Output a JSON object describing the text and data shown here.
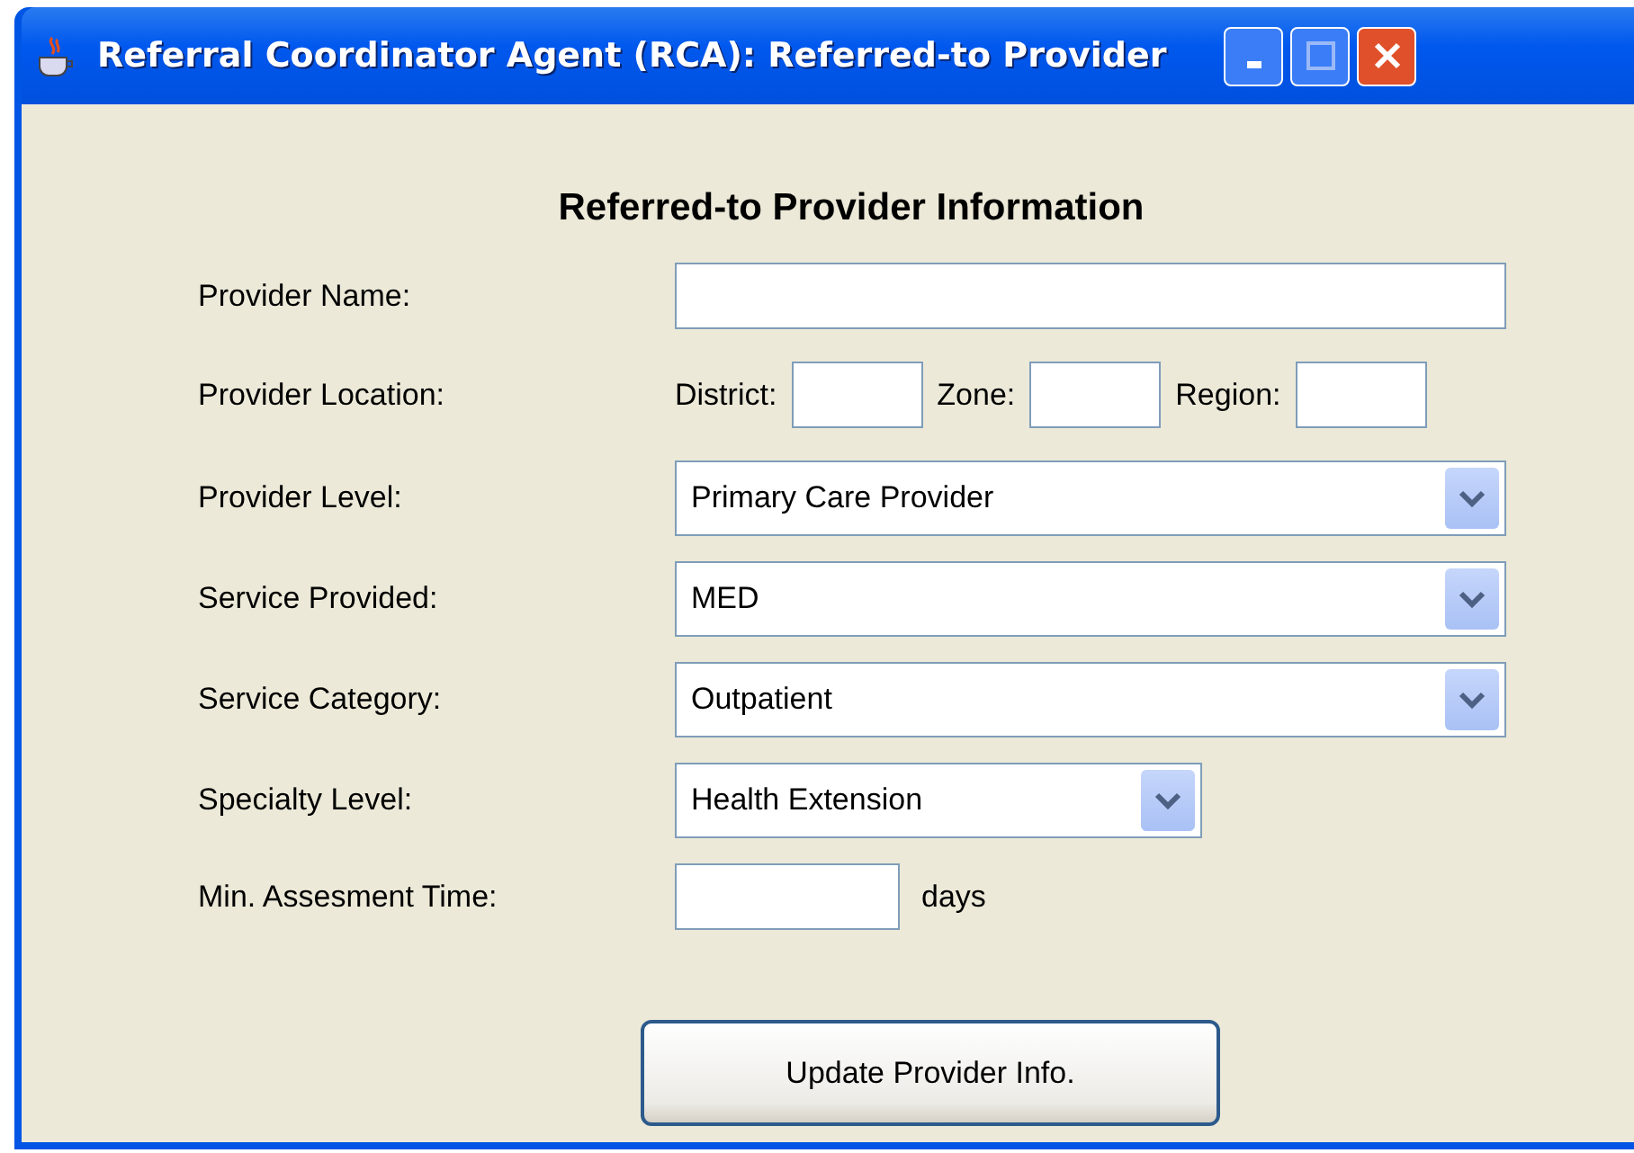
{
  "window": {
    "title": "Referral Coordinator Agent (RCA): Referred-to Provider"
  },
  "heading": "Referred-to Provider Information",
  "rows": [
    {
      "kind": "text",
      "label": "Provider Name:"
    },
    {
      "kind": "location",
      "label": "Provider Location:",
      "parts": [
        "District:",
        "Zone:",
        "Region:"
      ]
    },
    {
      "kind": "select",
      "label": "Provider Level:",
      "value": "Primary Care Provider"
    },
    {
      "kind": "select",
      "label": "Service Provided:",
      "value": "MED"
    },
    {
      "kind": "select",
      "label": "Service Category:",
      "value": "Outpatient"
    },
    {
      "kind": "select",
      "label": "Specialty Level:",
      "value": "Health Extension"
    },
    {
      "kind": "text",
      "label": "Min. Assesment Time:",
      "suffix": "days"
    }
  ],
  "button": "Update Provider Info."
}
